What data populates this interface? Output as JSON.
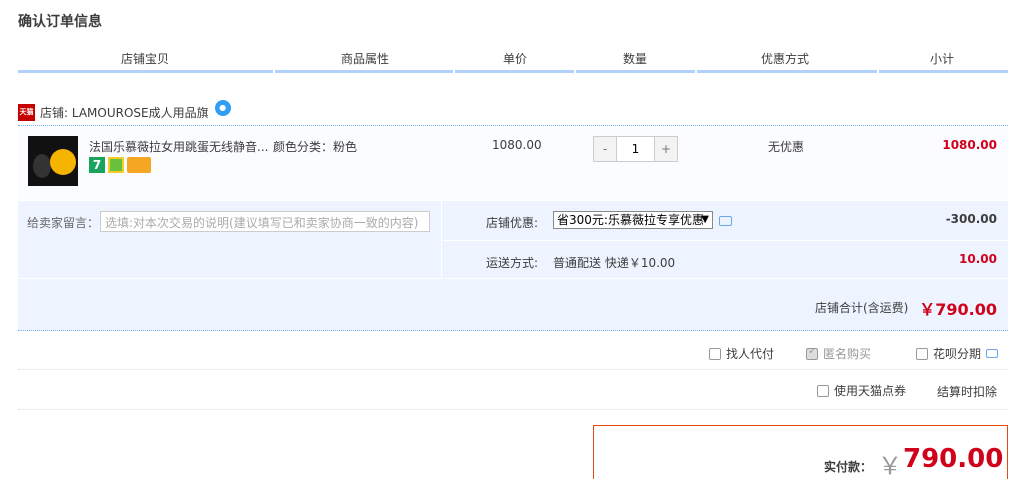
{
  "page_title": "确认订单信息",
  "columns": [
    "店铺宝贝",
    "商品属性",
    "单价",
    "数量",
    "优惠方式",
    "小计"
  ],
  "shop": {
    "badge": "天猫",
    "label": "店铺: LAMOUROSE成人用品旗"
  },
  "item": {
    "name": "法国乐慕薇拉女用跳蛋无线静音...",
    "attr": "颜色分类：粉色",
    "unit_price": "1080.00",
    "qty_minus": "-",
    "quantity": "1",
    "qty_plus": "+",
    "discount": "无优惠",
    "subtotal": "1080.00"
  },
  "message": {
    "label": "给卖家留言：",
    "placeholder": "选填:对本次交易的说明(建议填写已和卖家协商一致的内容)"
  },
  "shop_discount": {
    "label": "店铺优惠:",
    "selected": "省300元:乐慕薇拉专享优惠",
    "amount": "-300.00"
  },
  "shipping": {
    "label": "运送方式:",
    "value": "普通配送 快递￥10.00",
    "amount": "10.00"
  },
  "shop_total": {
    "label": "店铺合计(含运费)",
    "amount": "￥790.00"
  },
  "options": {
    "proxy_pay": "找人代付",
    "anonymous": "匿名购买",
    "huabei": "花呗分期",
    "tmall_points": "使用天猫点券",
    "deduct_note": "结算时扣除"
  },
  "payment": {
    "label": "实付款：",
    "currency": "￥",
    "amount": "790.00"
  },
  "colors": {
    "accent_red": "#d0021b",
    "header_line": "#b2d1ff",
    "panel_blue": "#eef4ff"
  }
}
